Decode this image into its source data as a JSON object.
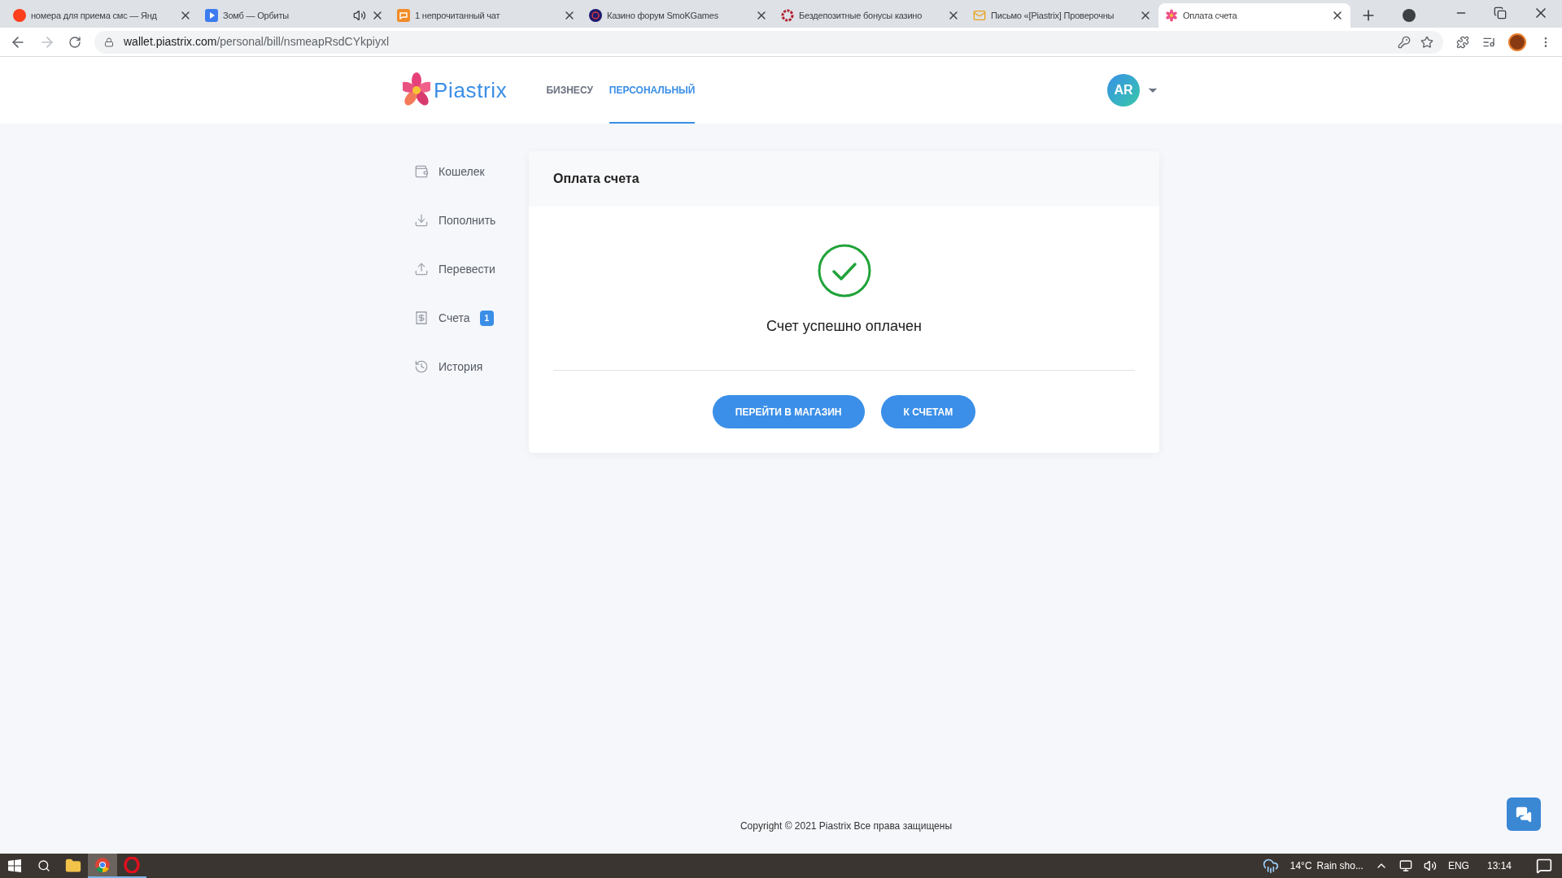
{
  "browser": {
    "tabs": [
      {
        "title": "номера для приема смс — Янд",
        "selected": false,
        "audio_playing": false
      },
      {
        "title": "Зомб — Орбиты",
        "selected": false,
        "audio_playing": true
      },
      {
        "title": "1 непрочитанный чат",
        "selected": false,
        "audio_playing": false
      },
      {
        "title": "Казино форум SmoKGames",
        "selected": false,
        "audio_playing": false
      },
      {
        "title": "Бездепозитные бонусы казино",
        "selected": false,
        "audio_playing": false
      },
      {
        "title": "Письмо «[Piastrix] Проверочны",
        "selected": false,
        "audio_playing": false
      },
      {
        "title": "Оплата счета",
        "selected": true,
        "audio_playing": false
      }
    ],
    "address": {
      "host": "wallet.piastrix.com",
      "path": "/personal/bill/nsmeapRsdCYkpiyxl"
    }
  },
  "header": {
    "logo": "Piastrix",
    "nav": [
      {
        "label": "БИЗНЕСУ",
        "selected": false
      },
      {
        "label": "ПЕРСОНАЛЬНЫЙ",
        "selected": true
      }
    ],
    "avatar": "AR"
  },
  "sidebar": {
    "items": [
      {
        "label": "Кошелек"
      },
      {
        "label": "Пополнить"
      },
      {
        "label": "Перевести"
      },
      {
        "label": "Счета",
        "badge": "1"
      },
      {
        "label": "История"
      }
    ]
  },
  "card": {
    "title": "Оплата счета",
    "message": "Счет успешно оплачен",
    "buttons": [
      "ПЕРЕЙТИ В МАГАЗИН",
      "К СЧЕТАМ"
    ]
  },
  "footer": "Copyright © 2021 Piastrix Все права защищены",
  "taskbar": {
    "apps": [
      {
        "selected": false
      },
      {
        "selected": true
      },
      {
        "selected": false
      }
    ],
    "temperature": "14°C",
    "weather": "Rain sho...",
    "language": "ENG",
    "time": "13:14"
  }
}
